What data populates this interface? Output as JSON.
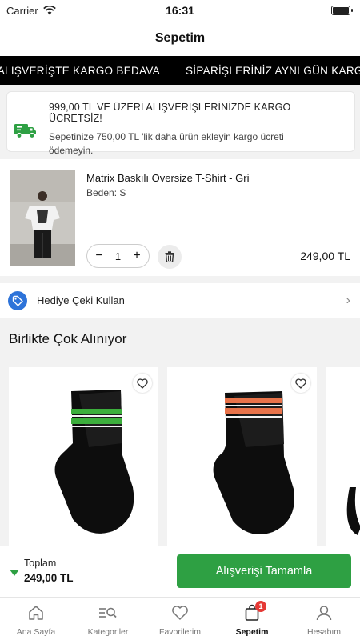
{
  "status_bar": {
    "carrier": "Carrier",
    "time": "16:31"
  },
  "header": {
    "title": "Sepetim"
  },
  "marquee": {
    "items": [
      "ERİ ALIŞVERİŞTE KARGO BEDAVA",
      "SİPARİŞLERİNİZ AYNI GÜN KARGO"
    ]
  },
  "cargo_info": {
    "title": "999,00 TL VE ÜZERİ ALIŞVERİŞLERİNİZDE KARGO ÜCRETSİZ!",
    "line1": "Sepetinize 750,00 TL 'lik daha ürün ekleyin kargo ücreti",
    "line2": "ödemeyin.",
    "icon": "truck-icon",
    "accent": "#2ea043"
  },
  "cart_item": {
    "name": "Matrix Baskılı Oversize T-Shirt - Gri",
    "size": "Beden: S",
    "quantity": "1",
    "price": "249,00 TL",
    "minus": "−",
    "plus": "+"
  },
  "gift_card": {
    "label": "Hediye Çeki Kullan",
    "icon": "tag-icon",
    "icon_color": "#2d73d9"
  },
  "recommended": {
    "title": "Birlikte Çok Alınıyor",
    "products": [
      {
        "stripe_color": "#3cae3c"
      },
      {
        "stripe_color": "#e8734a"
      }
    ]
  },
  "checkout": {
    "total_label": "Toplam",
    "total_value": "249,00 TL",
    "button": "Alışverişi Tamamla",
    "accent": "#2ea043"
  },
  "tabbar": {
    "tabs": [
      {
        "label": "Ana Sayfa",
        "icon": "home-icon"
      },
      {
        "label": "Kategoriler",
        "icon": "categories-search-icon"
      },
      {
        "label": "Favorilerim",
        "icon": "heart-icon"
      },
      {
        "label": "Sepetim",
        "icon": "shopping-bag-icon",
        "badge": "1",
        "active": true
      },
      {
        "label": "Hesabım",
        "icon": "user-icon"
      }
    ]
  }
}
